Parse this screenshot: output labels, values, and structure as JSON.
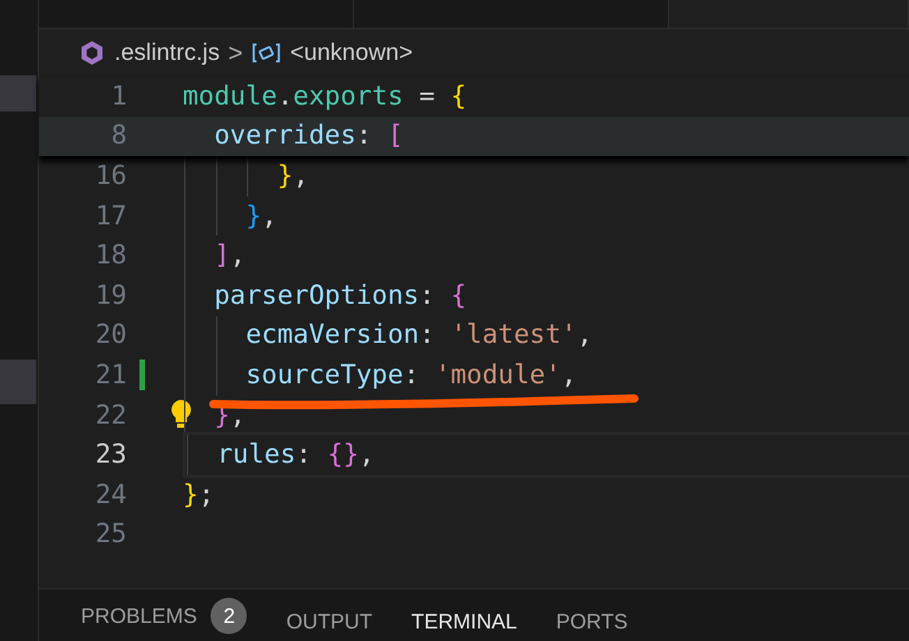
{
  "editor_tabs": [
    {
      "selected": false
    },
    {
      "selected": false
    },
    {
      "selected": true
    }
  ],
  "breadcrumb": {
    "file": ".eslintrc.js",
    "separator": ">",
    "symbol": "<unknown>"
  },
  "sticky_lines": [
    {
      "number": "1",
      "tokens": [
        {
          "text": "module",
          "kind": "var"
        },
        {
          "text": ".",
          "kind": "punct"
        },
        {
          "text": "exports",
          "kind": "var"
        },
        {
          "text": " = ",
          "kind": "punct"
        },
        {
          "text": "{",
          "kind": "bracket1"
        }
      ],
      "highlighted": false
    },
    {
      "number": "8",
      "tokens": [
        {
          "text": "  overrides",
          "kind": "prop"
        },
        {
          "text": ": ",
          "kind": "punct"
        },
        {
          "text": "[",
          "kind": "bracket2"
        }
      ],
      "highlighted": true
    }
  ],
  "lines": [
    {
      "number": "16",
      "tokens": [
        {
          "text": "      }",
          "kind": "bracket1"
        },
        {
          "text": ",",
          "kind": "punct"
        }
      ],
      "current": false,
      "modified": false,
      "lightbulb": false
    },
    {
      "number": "17",
      "tokens": [
        {
          "text": "    }",
          "kind": "bracket3"
        },
        {
          "text": ",",
          "kind": "punct"
        }
      ],
      "current": false,
      "modified": false,
      "lightbulb": false
    },
    {
      "number": "18",
      "tokens": [
        {
          "text": "  ]",
          "kind": "bracket2"
        },
        {
          "text": ",",
          "kind": "punct"
        }
      ],
      "current": false,
      "modified": false,
      "lightbulb": false
    },
    {
      "number": "19",
      "tokens": [
        {
          "text": "  parserOptions",
          "kind": "prop"
        },
        {
          "text": ": ",
          "kind": "punct"
        },
        {
          "text": "{",
          "kind": "bracket2"
        }
      ],
      "current": false,
      "modified": false,
      "lightbulb": false
    },
    {
      "number": "20",
      "tokens": [
        {
          "text": "    ecmaVersion",
          "kind": "prop"
        },
        {
          "text": ": ",
          "kind": "punct"
        },
        {
          "text": "'latest'",
          "kind": "string"
        },
        {
          "text": ",",
          "kind": "punct"
        }
      ],
      "current": false,
      "modified": false,
      "lightbulb": false
    },
    {
      "number": "21",
      "tokens": [
        {
          "text": "    sourceType",
          "kind": "prop"
        },
        {
          "text": ": ",
          "kind": "punct"
        },
        {
          "text": "'module'",
          "kind": "string"
        },
        {
          "text": ",",
          "kind": "punct"
        }
      ],
      "current": false,
      "modified": true,
      "lightbulb": false
    },
    {
      "number": "22",
      "tokens": [
        {
          "text": "  }",
          "kind": "bracket2"
        },
        {
          "text": ",",
          "kind": "punct"
        }
      ],
      "current": false,
      "modified": false,
      "lightbulb": true
    },
    {
      "number": "23",
      "tokens": [
        {
          "text": "  rules",
          "kind": "prop"
        },
        {
          "text": ": ",
          "kind": "punct"
        },
        {
          "text": "{}",
          "kind": "bracket2"
        },
        {
          "text": ",",
          "kind": "punct"
        }
      ],
      "current": true,
      "modified": false,
      "lightbulb": false
    },
    {
      "number": "24",
      "tokens": [
        {
          "text": "}",
          "kind": "bracket1"
        },
        {
          "text": ";",
          "kind": "punct"
        }
      ],
      "current": false,
      "modified": false,
      "lightbulb": false
    },
    {
      "number": "25",
      "current": false,
      "modified": false,
      "lightbulb": false
    }
  ],
  "panel_tabs": [
    {
      "label": "PROBLEMS",
      "badge": "2",
      "selected": false
    },
    {
      "label": "OUTPUT",
      "selected": false
    },
    {
      "label": "TERMINAL",
      "selected": true
    },
    {
      "label": "PORTS",
      "selected": false
    }
  ]
}
